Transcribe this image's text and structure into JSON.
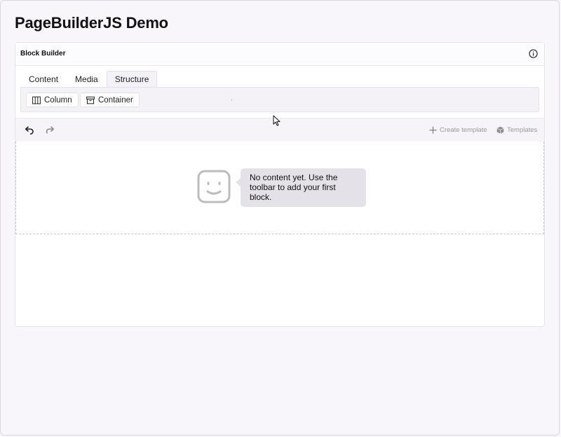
{
  "page": {
    "title": "PageBuilderJS Demo"
  },
  "builder": {
    "title": "Block Builder",
    "tabs": [
      {
        "label": "Content",
        "active": false
      },
      {
        "label": "Media",
        "active": false
      },
      {
        "label": "Structure",
        "active": true
      }
    ],
    "tools": [
      {
        "label": "Column",
        "icon": "columns-icon"
      },
      {
        "label": "Container",
        "icon": "archive-box-icon"
      }
    ],
    "edit_bar": {
      "undo_icon": "undo-icon",
      "redo_icon": "redo-icon",
      "create_template_label": "Create template",
      "templates_label": "Templates"
    },
    "empty_state": {
      "message": "No content yet. Use the toolbar to add your first block."
    }
  },
  "colors": {
    "page_bg": "#f8f6fb",
    "panel_bg": "#f4f2f7",
    "bubble_bg": "#e4e2e8",
    "muted_text": "#9a97a4"
  }
}
